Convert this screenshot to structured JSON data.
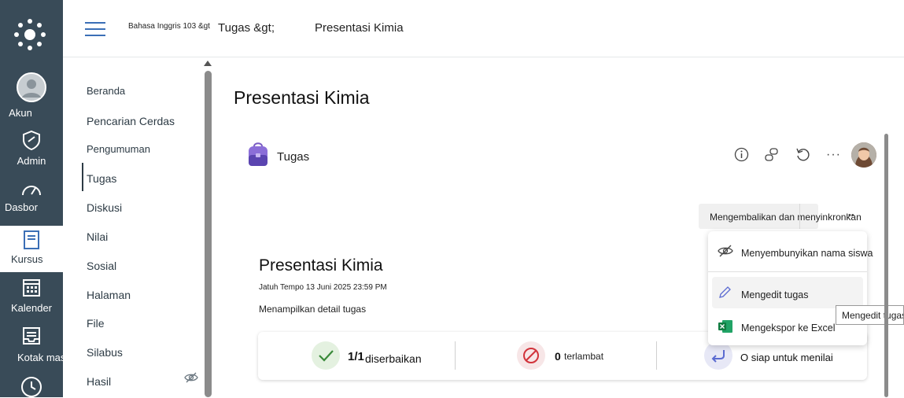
{
  "global_nav": {
    "items": [
      {
        "label": "Akun",
        "icon": "avatar-icon"
      },
      {
        "label": "Admin",
        "icon": "shield-icon"
      },
      {
        "label": "Dasbor",
        "icon": "dashboard-icon"
      },
      {
        "label": "Kursus",
        "icon": "book-icon"
      },
      {
        "label": "Kalender",
        "icon": "calendar-icon"
      },
      {
        "label": "Kotak mas",
        "icon": "inbox-icon"
      }
    ]
  },
  "header": {
    "course": "Bahasa Inggris 103 &gt",
    "section": "Tugas &gt;",
    "current": "Presentasi Kimia"
  },
  "course_nav": {
    "items": [
      "Beranda",
      "Pencarian Cerdas",
      "Pengumuman",
      "Tugas",
      "Diskusi",
      "Nilai",
      "Sosial",
      "Halaman",
      "File",
      "Silabus",
      "Hasil"
    ],
    "active": "Tugas"
  },
  "page": {
    "title": "Presentasi Kimia"
  },
  "app": {
    "title": "Tugas"
  },
  "sync_button": {
    "label": "Mengembalikan dan menyinkronkan"
  },
  "assignment": {
    "title": "Presentasi Kimia",
    "due": "Jatuh Tempo 13 Juni 2025 23:59 PM",
    "details_link": "Menampilkan detail tugas"
  },
  "stats": {
    "graded_count": "1/1",
    "graded_label": "diserbaikan",
    "late_count": "0",
    "late_label": "terlambat",
    "ready_label": "O siap untuk menilai"
  },
  "menu": {
    "items": [
      {
        "label": "Menyembunyikan nama siswa",
        "icon": "eye-off-icon"
      },
      {
        "label": "Mengedit tugas",
        "icon": "pencil-icon"
      },
      {
        "label": "Mengekspor ke Excel",
        "icon": "excel-icon"
      }
    ]
  },
  "tooltip": {
    "text": "Mengedit tugas"
  },
  "colors": {
    "nav_bg": "#394b58",
    "accent": "#3b6fb6",
    "success": "#3a8a3a",
    "danger": "#d1333b",
    "ready": "#5b6bd1"
  }
}
